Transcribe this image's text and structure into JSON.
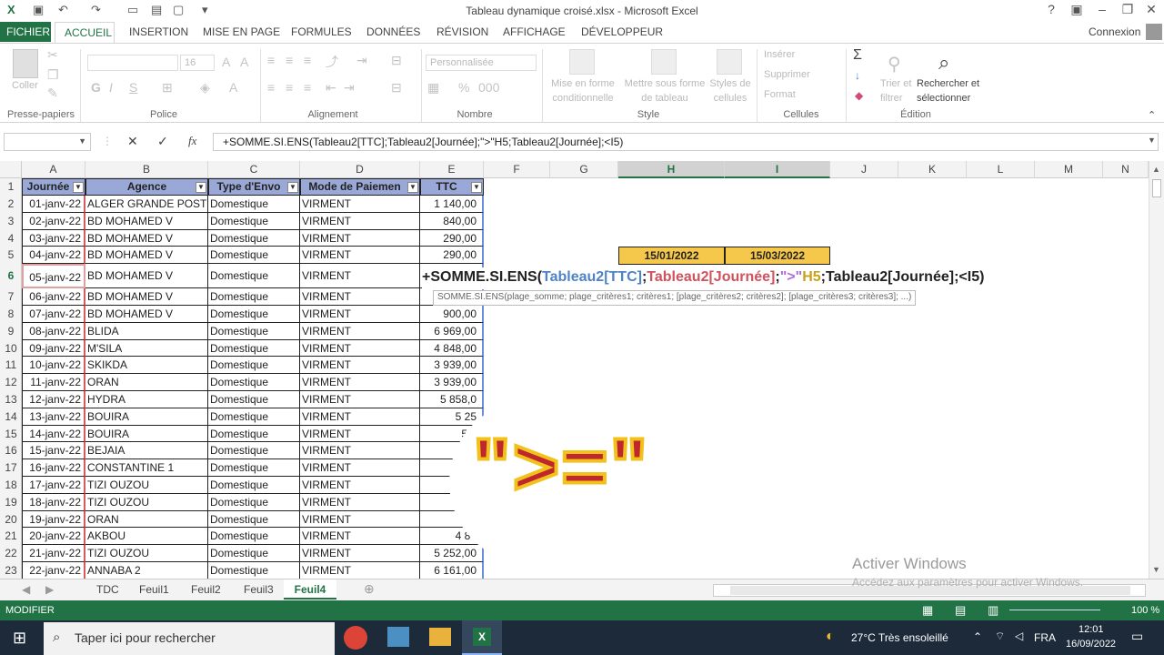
{
  "window": {
    "title": "Tableau dynamique croisé.xlsx - Microsoft Excel",
    "account": "Connexion"
  },
  "tabs": [
    "FICHIER",
    "ACCUEIL",
    "INSERTION",
    "MISE EN PAGE",
    "FORMULES",
    "DONNÉES",
    "RÉVISION",
    "AFFICHAGE",
    "DÉVELOPPEUR"
  ],
  "ribbon": {
    "coller": "Coller",
    "font_size": "16",
    "number_format": "Personnalisée",
    "styles": [
      "Mise en forme",
      "conditionnelle",
      "Mettre sous forme",
      "de tableau",
      "Styles de",
      "cellules"
    ],
    "cells": [
      "Insérer",
      "Supprimer",
      "Format"
    ],
    "edit": [
      "Trier et",
      "filtrer",
      "Rechercher et",
      "sélectionner"
    ],
    "groups": [
      "Presse-papiers",
      "Police",
      "Alignement",
      "Nombre",
      "Style",
      "Cellules",
      "Édition"
    ]
  },
  "formula": "+SOMME.SI.ENS(Tableau2[TTC];Tableau2[Journée];\">\"H5;Tableau2[Journée];<I5)",
  "columns": [
    "A",
    "B",
    "C",
    "D",
    "E",
    "F",
    "G",
    "H",
    "I",
    "J",
    "K",
    "L",
    "M",
    "N"
  ],
  "table": {
    "headers": [
      "Journée",
      "Agence",
      "Type d'Envo",
      "Mode de Paiemen",
      "TTC"
    ],
    "rows": [
      [
        "01-janv-22",
        "ALGER GRANDE POSTE",
        "Domestique",
        "VIRMENT",
        "1 140,00"
      ],
      [
        "02-janv-22",
        "BD MOHAMED V",
        "Domestique",
        "VIRMENT",
        "840,00"
      ],
      [
        "03-janv-22",
        "BD MOHAMED V",
        "Domestique",
        "VIRMENT",
        "290,00"
      ],
      [
        "04-janv-22",
        "BD MOHAMED V",
        "Domestique",
        "VIRMENT",
        "290,00"
      ],
      [
        "05-janv-22",
        "BD MOHAMED V",
        "Domestique",
        "VIRMENT",
        ""
      ],
      [
        "06-janv-22",
        "BD MOHAMED V",
        "Domestique",
        "VIRMENT",
        ""
      ],
      [
        "07-janv-22",
        "BD MOHAMED V",
        "Domestique",
        "VIRMENT",
        "900,00"
      ],
      [
        "08-janv-22",
        "BLIDA",
        "Domestique",
        "VIRMENT",
        "6 969,00"
      ],
      [
        "09-janv-22",
        "M'SILA",
        "Domestique",
        "VIRMENT",
        "4 848,00"
      ],
      [
        "10-janv-22",
        "SKIKDA",
        "Domestique",
        "VIRMENT",
        "3 939,00"
      ],
      [
        "11-janv-22",
        "ORAN",
        "Domestique",
        "VIRMENT",
        "3 939,00"
      ],
      [
        "12-janv-22",
        "HYDRA",
        "Domestique",
        "VIRMENT",
        "5 858,0"
      ],
      [
        "13-janv-22",
        "BOUIRA",
        "Domestique",
        "VIRMENT",
        "5 25"
      ],
      [
        "14-janv-22",
        "BOUIRA",
        "Domestique",
        "VIRMENT",
        "5 7"
      ],
      [
        "15-janv-22",
        "BEJAIA",
        "Domestique",
        "VIRMENT",
        "4"
      ],
      [
        "16-janv-22",
        "CONSTANTINE 1",
        "Domestique",
        "VIRMENT",
        "4"
      ],
      [
        "17-janv-22",
        "TIZI OUZOU",
        "Domestique",
        "VIRMENT",
        "6"
      ],
      [
        "18-janv-22",
        "TIZI OUZOU",
        "Domestique",
        "VIRMENT",
        "4"
      ],
      [
        "19-janv-22",
        "ORAN",
        "Domestique",
        "VIRMENT",
        "4 6"
      ],
      [
        "20-janv-22",
        "AKBOU",
        "Domestique",
        "VIRMENT",
        "4 84"
      ],
      [
        "21-janv-22",
        "TIZI OUZOU",
        "Domestique",
        "VIRMENT",
        "5 252,00"
      ],
      [
        "22-janv-22",
        "ANNABA 2",
        "Domestique",
        "VIRMENT",
        "6 161,00"
      ]
    ]
  },
  "criteria": {
    "h5": "15/01/2022",
    "i5": "15/03/2022"
  },
  "overlay_formula": {
    "prefix": "+SOMME.SI.ENS(",
    "ref1": "Tableau2[TTC]",
    "sep1": ";",
    "ref2": "Tableau2[Journée]",
    "sep2": ";",
    "crit": "\">\"",
    "ref3": "H5",
    "rest": ";Tableau2[Journée];<I5)"
  },
  "tooltip": "SOMME.SI.ENS(plage_somme; plage_critères1; critères1; [plage_critères2; critères2]; [plage_critères3; critères3]; ...)",
  "big_overlay": "\">=\"",
  "sheets": [
    "TDC",
    "Feuil1",
    "Feuil2",
    "Feuil3",
    "Feuil4"
  ],
  "status": {
    "mode": "MODIFIER",
    "zoom": "100 %"
  },
  "watermark": {
    "line1": "Activer Windows",
    "line2": "Accédez aux paramètres pour activer Windows."
  },
  "taskbar": {
    "search": "Taper ici pour rechercher",
    "weather": "27°C  Très ensoleillé",
    "lang": "FRA",
    "time": "12:01",
    "date": "16/09/2022"
  },
  "colors": {
    "excel_green": "#217346",
    "header_fill": "#9aa8d8",
    "criteria_fill": "#f5c84b",
    "overlay_red": "#c0262d",
    "overlay_yellow": "#f2c21a"
  }
}
